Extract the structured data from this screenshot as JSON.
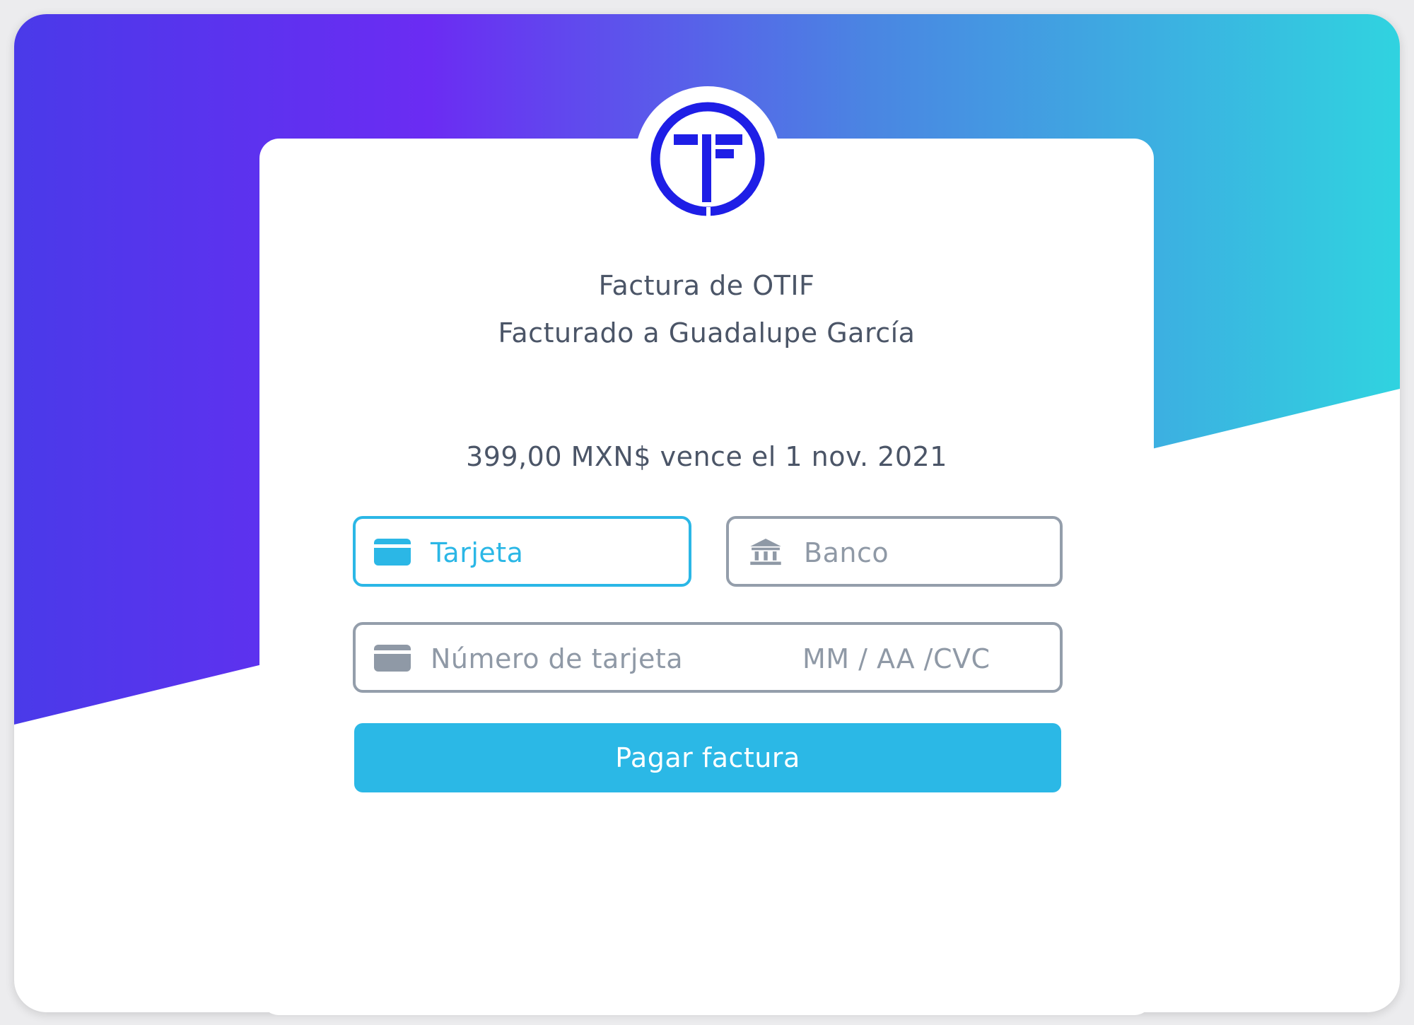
{
  "invoice": {
    "title": "Factura de OTIF",
    "billed_to": "Facturado a Guadalupe García",
    "amount_due": "399,00 MXN$ vence el 1 nov. 2021"
  },
  "payment_methods": [
    {
      "label": "Tarjeta",
      "icon": "credit-card-icon",
      "selected": true
    },
    {
      "label": "Banco",
      "icon": "bank-icon",
      "selected": false
    }
  ],
  "card_field": {
    "number_placeholder": "Número de tarjeta",
    "expiry_placeholder": "MM / AA /CVC"
  },
  "pay_button": {
    "label": "Pagar factura"
  },
  "colors": {
    "accent": "#2bb8e6",
    "text": "#4b5567",
    "muted": "#8f99a6",
    "logo_blue": "#1e1ee6",
    "gradient": [
      "#4a3ae9",
      "#6b2cf3",
      "#4a86e2",
      "#30d3e0"
    ]
  }
}
